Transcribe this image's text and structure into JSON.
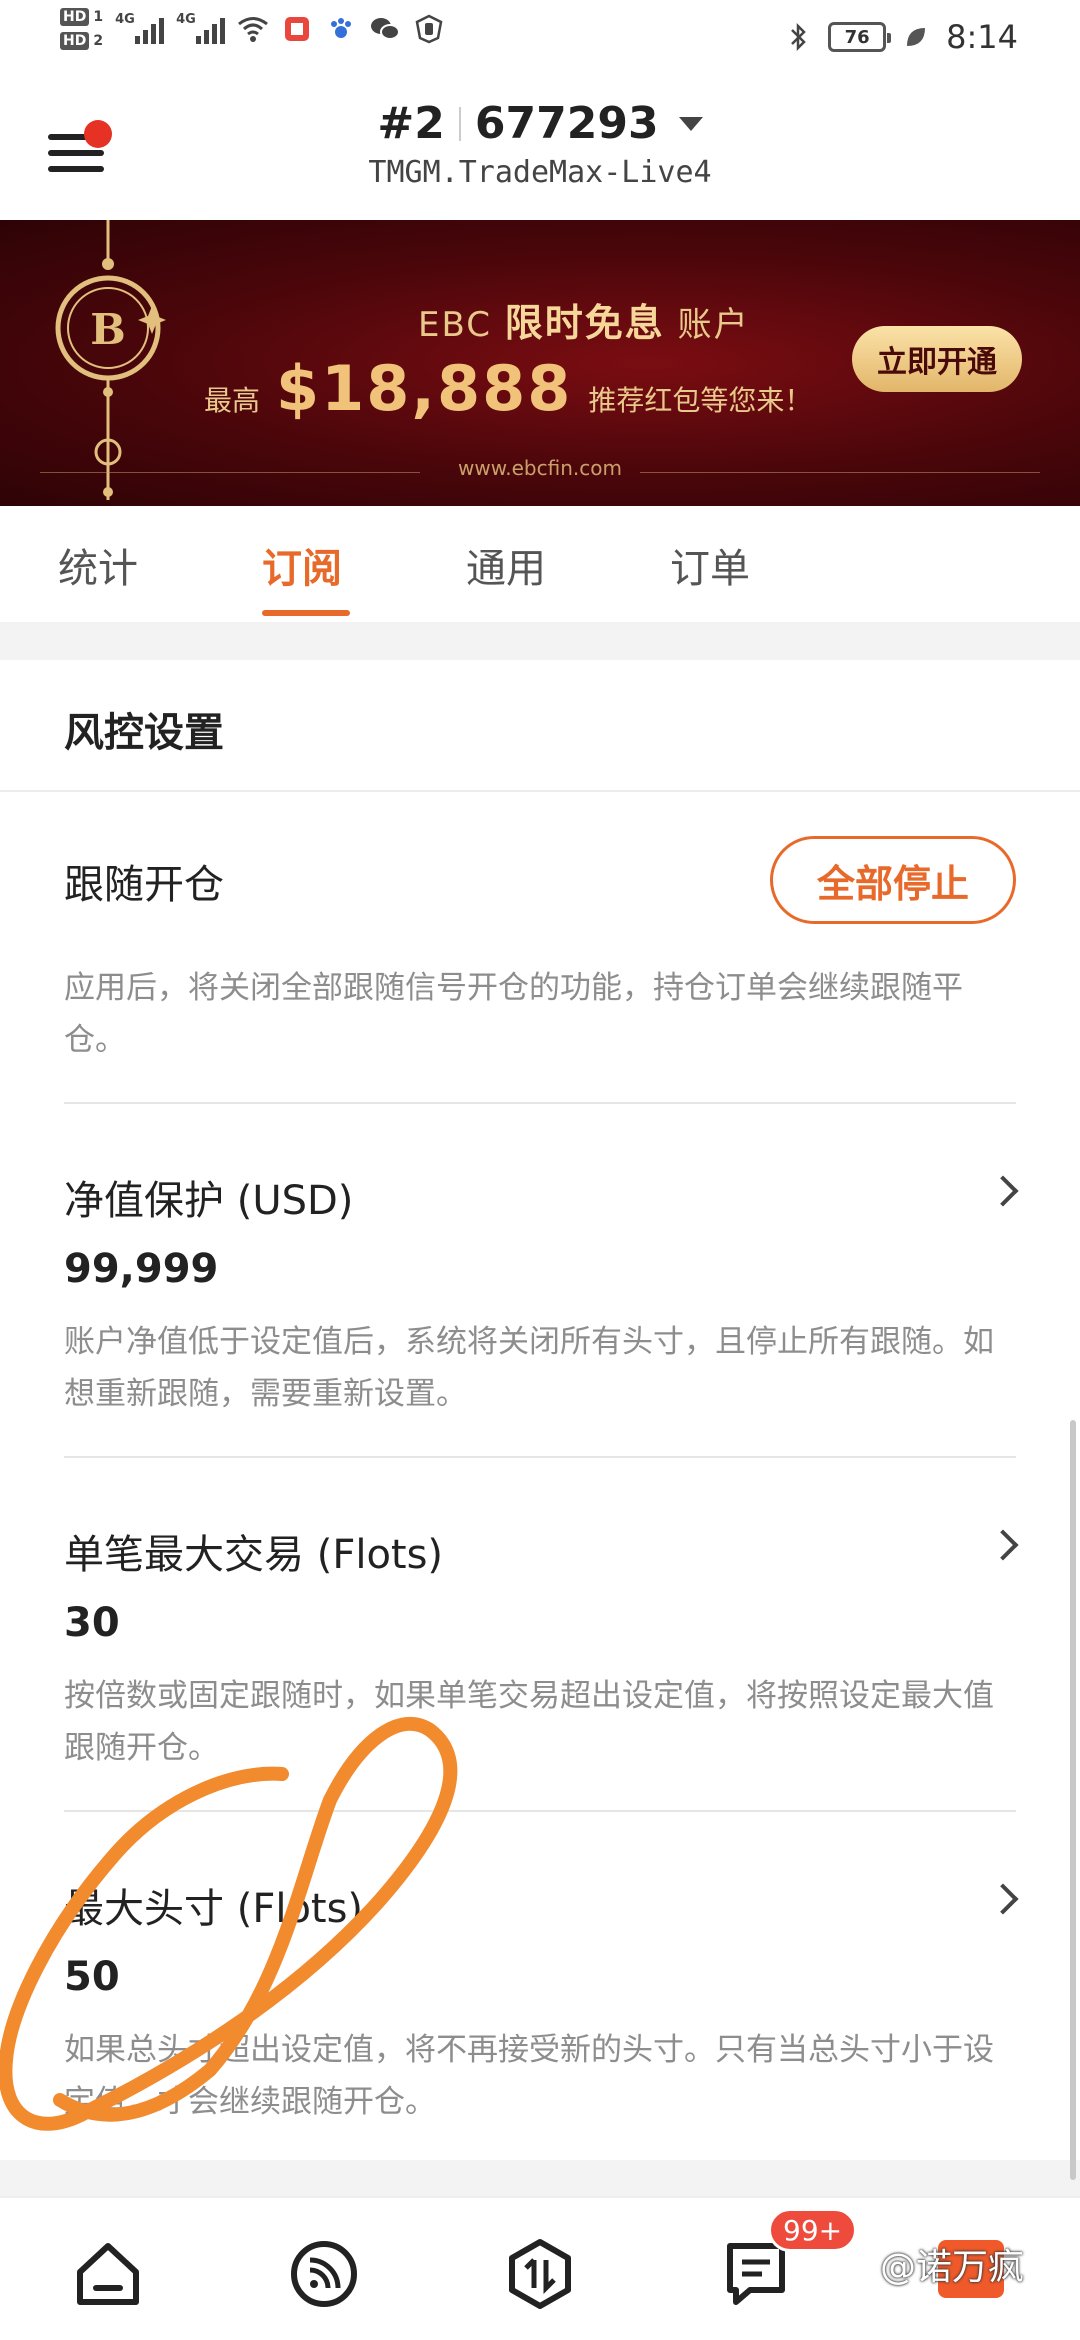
{
  "status_bar": {
    "hd1": "HD",
    "hd1_num": "1",
    "hd2": "HD",
    "hd2_num": "2",
    "net1": "4G",
    "net2": "4G",
    "battery": "76",
    "time": "8:14"
  },
  "header": {
    "account_index": "#2",
    "account_number": "677293",
    "server": "TMGM.TradeMax-Live4"
  },
  "banner": {
    "brand": "EBC",
    "headline_highlight": "限时免息",
    "headline_suffix": "账户",
    "prefix": "最高",
    "amount": "$18,888",
    "suffix": "推荐红包等您来！",
    "cta": "立即开通",
    "url": "www.ebcfin.com"
  },
  "tabs": [
    "统计",
    "订阅",
    "通用",
    "订单"
  ],
  "active_tab": "订阅",
  "risk": {
    "section_title": "风控设置",
    "follow": {
      "title": "跟随开仓",
      "button": "全部停止",
      "desc": "应用后，将关闭全部跟随信号开仓的功能，持仓订单会继续跟随平仓。"
    },
    "equity": {
      "title": "净值保护 (USD)",
      "value": "99,999",
      "desc": "账户净值低于设定值后，系统将关闭所有头寸，且停止所有跟随。如想重新跟随，需要重新设置。"
    },
    "max_trade": {
      "title": "单笔最大交易 (Flots)",
      "value": "30",
      "desc": "按倍数或固定跟随时，如果单笔交易超出设定值，将按照设定最大值跟随开仓。"
    },
    "max_position": {
      "title": "最大头寸 (Flots)",
      "value": "50",
      "desc": "如果总头寸超出设定值，将不再接受新的头寸。只有当总头寸小于设定值，才会继续跟随开仓。"
    }
  },
  "bottom_nav": {
    "badge": "99+",
    "watermark": "@诺万疯"
  },
  "colors": {
    "accent": "#e86a2b",
    "banner_bg": "#4a060a",
    "gold": "#e9c88b",
    "badge": "#ef4b3c",
    "annotation": "#f28a2e"
  }
}
